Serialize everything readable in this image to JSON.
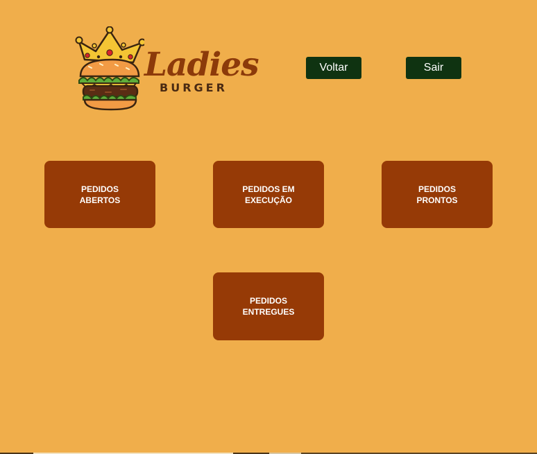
{
  "header": {
    "logo": {
      "title": "Ladies",
      "subtitle": "BURGER",
      "icon": "crowned-burger-icon"
    },
    "buttons": {
      "back_label": "Voltar",
      "exit_label": "Sair"
    }
  },
  "tiles": {
    "open": {
      "line1": "PEDIDOS",
      "line2": "ABERTOS"
    },
    "in_progress": {
      "line1": "PEDIDOS EM",
      "line2": "EXECUÇÃO"
    },
    "ready": {
      "line1": "PEDIDOS",
      "line2": "PRONTOS"
    },
    "delivered": {
      "line1": "PEDIDOS",
      "line2": "ENTREGUES"
    }
  },
  "colors": {
    "background": "#f0ae4b",
    "tile": "#963a06",
    "header_button": "#0f3311",
    "logo_text": "#8c3a0a"
  }
}
